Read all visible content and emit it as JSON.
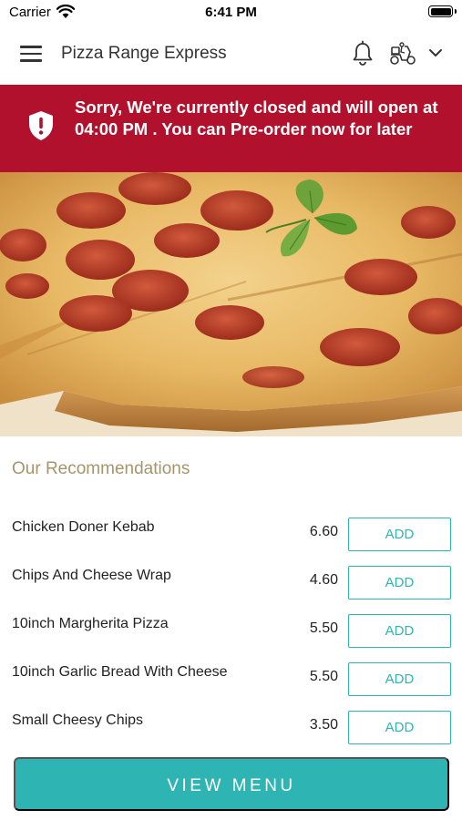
{
  "status_bar": {
    "carrier": "Carrier",
    "time": "6:41 PM"
  },
  "header": {
    "title": "Pizza Range Express",
    "icons": [
      "menu-icon",
      "bell-icon",
      "delivery-scooter-icon",
      "chevron-down-icon"
    ]
  },
  "banner": {
    "message": "Sorry, We're currently closed and will open at 04:00 PM . You can Pre-order now for later",
    "icon": "shield-alert-icon",
    "color": "#b1112c"
  },
  "recommendations": {
    "title": "Our Recommendations",
    "items": [
      {
        "name": "Chicken Doner Kebab",
        "price": "6.60",
        "button": "ADD"
      },
      {
        "name": "Chips And Cheese Wrap",
        "price": "4.60",
        "button": "ADD"
      },
      {
        "name": "10inch Margherita Pizza",
        "price": "5.50",
        "button": "ADD"
      },
      {
        "name": "10inch Garlic Bread With Cheese",
        "price": "5.50",
        "button": "ADD"
      },
      {
        "name": "Small Cheesy Chips",
        "price": "3.50",
        "button": "ADD"
      }
    ]
  },
  "view_menu": {
    "label": "VIEW MENU"
  },
  "colors": {
    "accent": "#2fb4b4",
    "alert": "#b1112c",
    "section_title": "#a8946b"
  }
}
